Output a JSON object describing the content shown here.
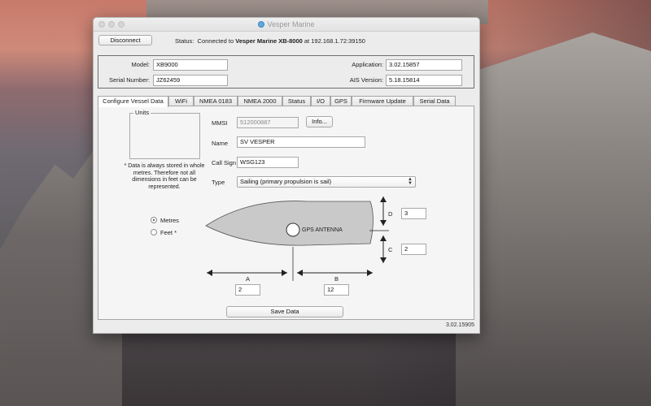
{
  "window": {
    "title": "Vesper Marine",
    "version_footer": "3.02.15905"
  },
  "connection": {
    "disconnect_label": "Disconnect",
    "status_label": "Status:",
    "status_prefix": "Connected to",
    "device_name": "Vesper Marine XB-8000",
    "status_suffix": "at 192.168.1.72:39150"
  },
  "device_info": {
    "model_label": "Model:",
    "model_value": "XB9000",
    "serial_label": "Serial Number:",
    "serial_value": "JZ62459",
    "application_label": "Application:",
    "application_value": "3.02.15857",
    "ais_label": "AIS Version:",
    "ais_value": "5.18.15814"
  },
  "tabs": [
    {
      "label": "Configure Vessel Data",
      "active": true
    },
    {
      "label": "WiFi",
      "active": false
    },
    {
      "label": "NMEA 0183",
      "active": false
    },
    {
      "label": "NMEA 2000",
      "active": false
    },
    {
      "label": "Status",
      "active": false
    },
    {
      "label": "I/O",
      "active": false
    },
    {
      "label": "GPS",
      "active": false
    },
    {
      "label": "Firmware Update",
      "active": false
    },
    {
      "label": "Serial Data",
      "active": false
    }
  ],
  "vessel": {
    "mmsi_label": "MMSI",
    "mmsi_value": "512000887",
    "info_button": "Info...",
    "name_label": "Name",
    "name_value": "SV VESPER",
    "callsign_label": "Call Sign",
    "callsign_value": "WSG123",
    "type_label": "Type",
    "type_value": "Sailing (primary propulsion is sail)"
  },
  "units": {
    "legend": "Units",
    "metres_label": "Metres",
    "feet_label": "Feet *",
    "selected": "Metres",
    "note": "* Data is always stored in whole metres. Therefore not all dimensions in feet can be represented."
  },
  "diagram": {
    "gps_label": "GPS ANTENNA",
    "a_label": "A",
    "a_value": "2",
    "b_label": "B",
    "b_value": "12",
    "c_label": "C",
    "c_value": "2",
    "d_label": "D",
    "d_value": "3"
  },
  "actions": {
    "save_label": "Save Data"
  },
  "colors": {
    "hull_fill": "#c9c9c9",
    "accent": "#5fa8e0"
  }
}
